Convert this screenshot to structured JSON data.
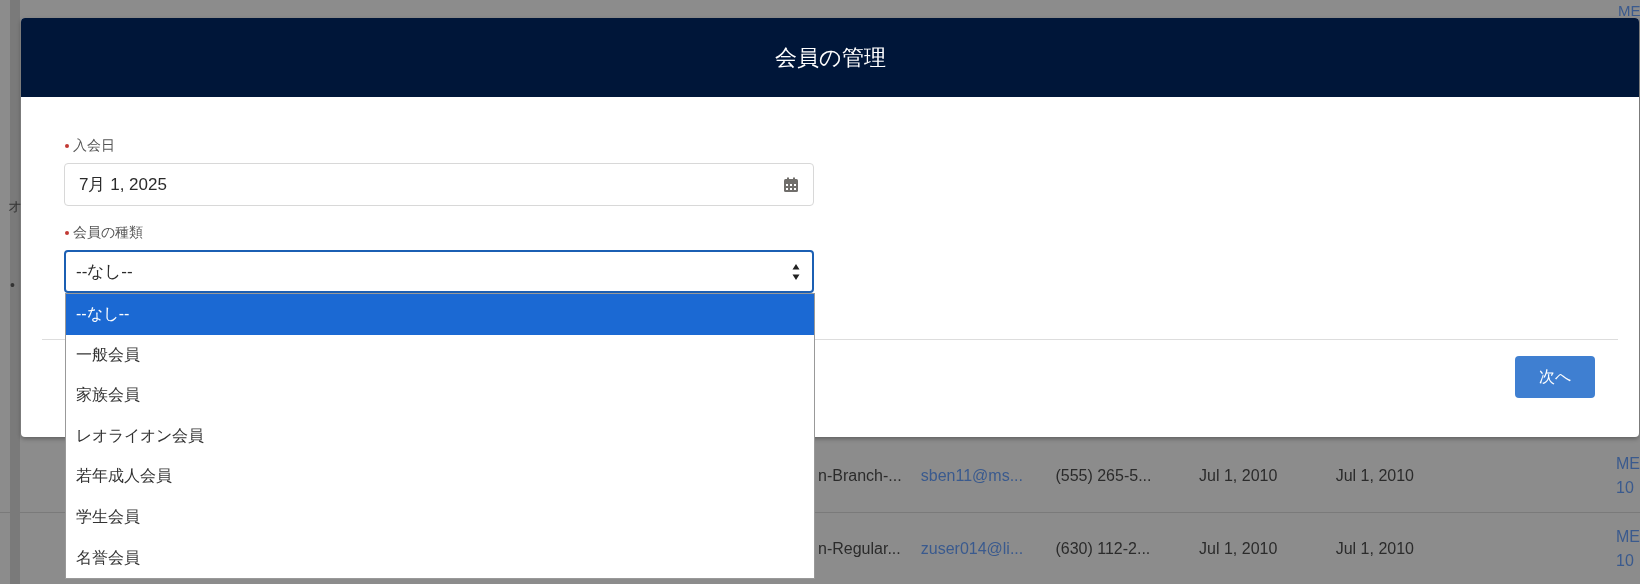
{
  "background": {
    "side_fragments": [
      "オ",
      "•"
    ],
    "rows": [
      {
        "cells": [
          "n-Branch-...",
          "sben11@ms...",
          "(555) 265-5...",
          "Jul 1, 2010",
          "Jul 1, 2010"
        ],
        "link_lines": [
          "ME",
          "10"
        ]
      },
      {
        "cells": [
          "n-Regular...",
          "zuser014@li...",
          "(630) 112-2...",
          "Jul 1, 2010",
          "Jul 1, 2010"
        ],
        "link_lines": [
          "ME",
          "10"
        ]
      }
    ],
    "top_link": "ME"
  },
  "dialog": {
    "title": "会員の管理",
    "fields": [
      {
        "kind": "date",
        "label": "入会日",
        "required": true,
        "value": "7月 1, 2025",
        "focused": false
      },
      {
        "kind": "select",
        "label": "会員の種類",
        "required": true,
        "value": "--なし--",
        "focused": true,
        "options": [
          {
            "label": "--なし--",
            "selected": true
          },
          {
            "label": "一般会員",
            "selected": false
          },
          {
            "label": "家族会員",
            "selected": false
          },
          {
            "label": "レオライオン会員",
            "selected": false
          },
          {
            "label": "若年成人会員",
            "selected": false
          },
          {
            "label": "学生会員",
            "selected": false
          },
          {
            "label": "名誉会員",
            "selected": false
          }
        ]
      }
    ],
    "next_button": "次へ"
  }
}
